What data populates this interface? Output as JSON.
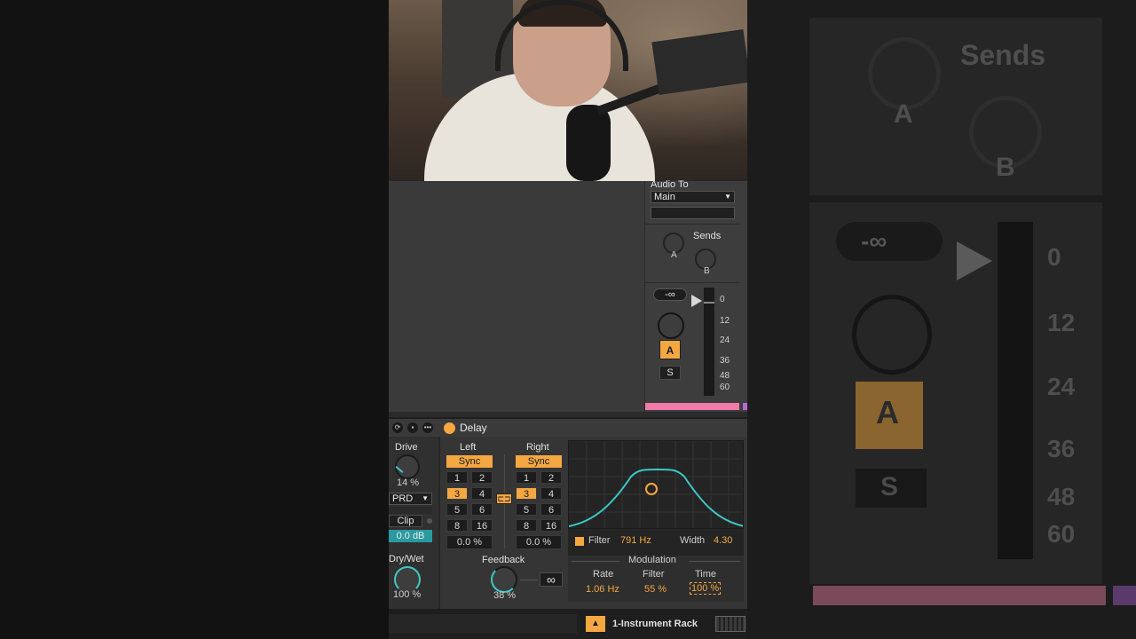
{
  "background": {
    "sends_title": "Sends",
    "send_a": "A",
    "send_b": "B",
    "inf_value": "-∞",
    "meter_0": "0",
    "meter_12": "12",
    "meter_24": "24",
    "meter_36": "36",
    "meter_48": "48",
    "meter_60": "60",
    "arm_a": "A",
    "solo": "S"
  },
  "mixer": {
    "audio_to_label": "Audio To",
    "audio_to_value": "Main",
    "sends_label": "Sends",
    "send_a": "A",
    "send_b": "B",
    "volume_value": "-∞",
    "meter_labels": [
      "0",
      "12",
      "24",
      "36",
      "48",
      "60"
    ],
    "activator_label": "A",
    "solo_label": "S",
    "track_color": "#f07aa8",
    "next_track_color": "#b36bd6"
  },
  "device": {
    "title": "Delay",
    "left_panel": {
      "drive_label": "Drive",
      "drive_value": "14 %",
      "mode_value": "PRD",
      "clip_label": "Clip",
      "clip_value": "0.0 dB",
      "drywet_label": "Dry/Wet",
      "drywet_value": "100 %"
    },
    "left_channel": {
      "label": "Left",
      "sync": "Sync",
      "grid": [
        "1",
        "2",
        "3",
        "4",
        "5",
        "6",
        "8",
        "16"
      ],
      "active": "3",
      "offset": "0.0 %"
    },
    "right_channel": {
      "label": "Right",
      "sync": "Sync",
      "grid": [
        "1",
        "2",
        "3",
        "4",
        "5",
        "6",
        "8",
        "16"
      ],
      "active": "3",
      "offset": "0.0 %"
    },
    "feedback_label": "Feedback",
    "feedback_value": "38 %",
    "freeze_symbol": "∞",
    "filter_label": "Filter",
    "filter_value": "791 Hz",
    "width_label": "Width",
    "width_value": "4.30",
    "modulation_label": "Modulation",
    "rate_label": "Rate",
    "rate_value": "1.06 Hz",
    "mod_filter_label": "Filter",
    "mod_filter_value": "55 %",
    "time_label": "Time",
    "time_value": "100 %",
    "accent_color": "#f5a742",
    "curve_color": "#3ec8c8"
  },
  "bottom_bar": {
    "rack_name": "1-Instrument Rack"
  }
}
